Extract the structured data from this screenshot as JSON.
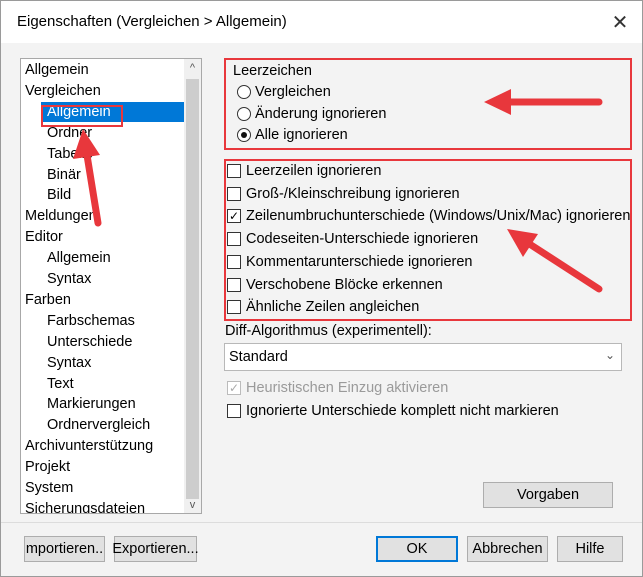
{
  "window": {
    "title": "Eigenschaften (Vergleichen > Allgemein)",
    "close_glyph": "✕"
  },
  "tree": {
    "items": [
      {
        "label": "Allgemein",
        "level": 0,
        "selected": false
      },
      {
        "label": "Vergleichen",
        "level": 0,
        "selected": false
      },
      {
        "label": "Allgemein",
        "level": 1,
        "selected": true
      },
      {
        "label": "Ordner",
        "level": 1,
        "selected": false
      },
      {
        "label": "Tabelle",
        "level": 1,
        "selected": false
      },
      {
        "label": "Binär",
        "level": 1,
        "selected": false
      },
      {
        "label": "Bild",
        "level": 1,
        "selected": false
      },
      {
        "label": "Meldungen",
        "level": 0,
        "selected": false
      },
      {
        "label": "Editor",
        "level": 0,
        "selected": false
      },
      {
        "label": "Allgemein",
        "level": 1,
        "selected": false
      },
      {
        "label": "Syntax",
        "level": 1,
        "selected": false
      },
      {
        "label": "Farben",
        "level": 0,
        "selected": false
      },
      {
        "label": "Farbschemas",
        "level": 1,
        "selected": false
      },
      {
        "label": "Unterschiede",
        "level": 1,
        "selected": false
      },
      {
        "label": "Syntax",
        "level": 1,
        "selected": false
      },
      {
        "label": "Text",
        "level": 1,
        "selected": false
      },
      {
        "label": "Markierungen",
        "level": 1,
        "selected": false
      },
      {
        "label": "Ordnervergleich",
        "level": 1,
        "selected": false
      },
      {
        "label": "Archivunterstützung",
        "level": 0,
        "selected": false
      },
      {
        "label": "Projekt",
        "level": 0,
        "selected": false
      },
      {
        "label": "System",
        "level": 0,
        "selected": false
      },
      {
        "label": "Sicherungsdateien",
        "level": 0,
        "selected": false
      }
    ],
    "scroll_up": "^",
    "scroll_down": "v"
  },
  "whitespace": {
    "label": "Leerzeichen",
    "options": [
      {
        "label": "Vergleichen",
        "checked": false
      },
      {
        "label": "Änderung ignorieren",
        "checked": false
      },
      {
        "label": "Alle ignorieren",
        "checked": true
      }
    ]
  },
  "checkboxes": [
    {
      "label": "Leerzeilen ignorieren",
      "checked": false
    },
    {
      "label": "Groß-/Kleinschreibung ignorieren",
      "checked": false
    },
    {
      "label": "Zeilenumbruchunterschiede (Windows/Unix/Mac) ignorieren",
      "checked": true
    },
    {
      "label": "Codeseiten-Unterschiede ignorieren",
      "checked": false
    },
    {
      "label": "Kommentarunterschiede ignorieren",
      "checked": false
    },
    {
      "label": "Verschobene Blöcke erkennen",
      "checked": false
    },
    {
      "label": "Ähnliche Zeilen angleichen",
      "checked": false
    }
  ],
  "diff_algorithm": {
    "label": "Diff-Algorithmus (experimentell):",
    "selected": "Standard"
  },
  "heuristic": {
    "label": "Heuristischen Einzug aktivieren",
    "checked": true,
    "disabled": true
  },
  "ignored_unmarked": {
    "label": "Ignorierte Unterschiede komplett nicht markieren",
    "checked": false
  },
  "buttons": {
    "defaults": "Vorgaben",
    "import": "mportieren..",
    "export": "Exportieren...",
    "ok": "OK",
    "cancel": "Abbrechen",
    "help": "Hilfe"
  },
  "colors": {
    "selection": "#0078d7",
    "annotation_red": "#e8373c"
  }
}
